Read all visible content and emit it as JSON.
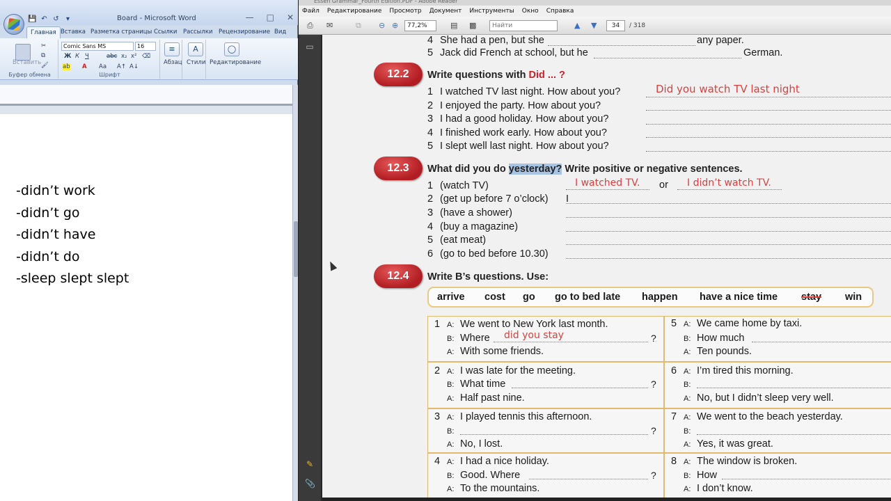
{
  "word": {
    "title": "Board - Microsoft Word",
    "tabs": [
      "Главная",
      "Вставка",
      "Разметка страницы",
      "Ссылки",
      "Рассылки",
      "Рецензирование",
      "Вид"
    ],
    "font_name": "Comic Sans MS",
    "font_size": "16",
    "groups": {
      "clipboard": "Буфер обмена",
      "font": "Шрифт",
      "paragraph": "Абзац",
      "styles": "Стили",
      "editing": "Редактирование"
    },
    "paste_label": "Вставить",
    "doc_lines": [
      "-didn’t work",
      "-didn’t go",
      "-didn’t have",
      "-didn’t do",
      "-sleep slept slept"
    ]
  },
  "reader": {
    "title": "Essen Grammar_Fourth Edition.PDF - Adobe Reader",
    "menu": [
      "Файл",
      "Редактирование",
      "Просмотр",
      "Документ",
      "Инструменты",
      "Окно",
      "Справка"
    ],
    "zoom": "77,2%",
    "find_placeholder": "Найти",
    "page_current": "34",
    "page_total": "/ 318"
  },
  "page": {
    "top_items": [
      {
        "num": "4",
        "text": "She had a pen, but she",
        "end": "any paper."
      },
      {
        "num": "5",
        "text": "Jack did French at school, but he",
        "end": "German."
      }
    ],
    "ex122": {
      "badge": "12.2",
      "heading_pre": "Write questions with ",
      "heading_red": "Did ... ?",
      "items": [
        {
          "num": "1",
          "text": "I watched TV last night. How about you?",
          "answer": "Did you watch TV last night"
        },
        {
          "num": "2",
          "text": "I enjoyed the party. How about you?"
        },
        {
          "num": "3",
          "text": "I had a good holiday. How about you?"
        },
        {
          "num": "4",
          "text": "I finished work early. How about you?"
        },
        {
          "num": "5",
          "text": "I slept well last night. How about you?"
        }
      ]
    },
    "ex123": {
      "badge": "12.3",
      "heading_pre": "What did you do ",
      "heading_hl": "yesterday?",
      "heading_post": " Write positive or negative sentences.",
      "or": "or",
      "items": [
        {
          "num": "1",
          "text": "(watch TV)",
          "answer_pos": "I watched TV.",
          "answer_neg": "I didn’t watch TV."
        },
        {
          "num": "2",
          "text": "(get up before 7 o’clock)",
          "start": "I"
        },
        {
          "num": "3",
          "text": "(have a shower)"
        },
        {
          "num": "4",
          "text": "(buy a magazine)"
        },
        {
          "num": "5",
          "text": "(eat meat)"
        },
        {
          "num": "6",
          "text": "(go to bed before 10.30)"
        }
      ]
    },
    "ex124": {
      "badge": "12.4",
      "heading_pre": "Write B’s questions. Use:",
      "words": [
        "arrive",
        "cost",
        "go",
        "go to bed late",
        "happen",
        "have a nice time",
        "stay",
        "win"
      ],
      "cells": [
        {
          "num": "1",
          "a1": "We went to New York last month.",
          "b": "Where",
          "b_answer": "did you stay",
          "q": "?",
          "a2": "With some friends."
        },
        {
          "num": "2",
          "a1": "I was late for the meeting.",
          "b": "What time",
          "q": "?",
          "a2": "Half past nine."
        },
        {
          "num": "3",
          "a1": "I played tennis this afternoon.",
          "b": "",
          "q": "?",
          "a2": "No, I lost."
        },
        {
          "num": "4",
          "a1": "I had a nice holiday.",
          "b": "Good. Where",
          "q": "?",
          "a2": "To the mountains."
        },
        {
          "num": "5",
          "a1": "We came home by taxi.",
          "b": "How much",
          "a2": "Ten pounds."
        },
        {
          "num": "6",
          "a1": "I’m tired this morning.",
          "b": "",
          "a2": "No, but I didn’t sleep very well."
        },
        {
          "num": "7",
          "a1": "We went to the beach yesterday.",
          "b": "",
          "a2": "Yes, it was great."
        },
        {
          "num": "8",
          "a1": "The window is broken.",
          "b": "How",
          "a2": "I don’t know."
        }
      ],
      "label_a": "A:",
      "label_b": "B:"
    }
  }
}
